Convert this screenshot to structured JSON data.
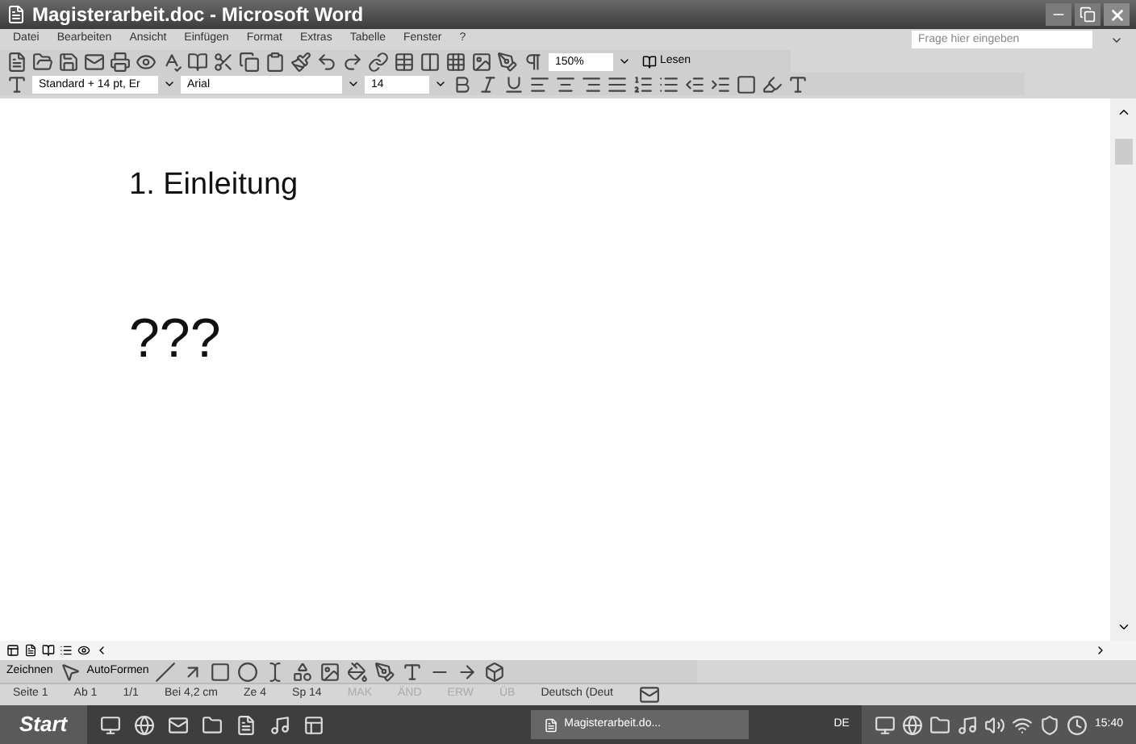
{
  "window": {
    "title": "Magisterarbeit.doc - Microsoft Word"
  },
  "menu": [
    "Datei",
    "Bearbeiten",
    "Ansicht",
    "Einfügen",
    "Format",
    "Extras",
    "Tabelle",
    "Fenster",
    "?"
  ],
  "help": {
    "placeholder": "Frage hier eingeben"
  },
  "standard_toolbar": {
    "zoom": "150%",
    "read_button": "Lesen"
  },
  "formatting_toolbar": {
    "style": "Standard + 14 pt, Er",
    "font": "Arial",
    "size": "14"
  },
  "document": {
    "paragraphs": [
      {
        "kind": "heading",
        "text": "1. Einleitung"
      },
      {
        "kind": "large",
        "text": "???"
      }
    ]
  },
  "drawing_toolbar": {
    "draw_menu": "Zeichnen",
    "autoshapes_menu": "AutoFormen"
  },
  "status_bar": [
    {
      "text": "Seite 1",
      "disabled": false
    },
    {
      "text": "Ab 1",
      "disabled": false
    },
    {
      "text": "1/1",
      "disabled": false
    },
    {
      "text": "Bei 4,2 cm",
      "disabled": false
    },
    {
      "text": "Ze 4",
      "disabled": false
    },
    {
      "text": "Sp 14",
      "disabled": false
    },
    {
      "text": "MAK",
      "disabled": true
    },
    {
      "text": "ÄND",
      "disabled": true
    },
    {
      "text": "ERW",
      "disabled": true
    },
    {
      "text": "ÜB",
      "disabled": true
    },
    {
      "text": "Deutsch (Deut",
      "disabled": false
    }
  ],
  "taskbar": {
    "start": "Start",
    "tasks": [
      {
        "label": "Magisterarbeit.do...",
        "selected": true
      }
    ],
    "language": "DE",
    "clock": "15:40"
  }
}
